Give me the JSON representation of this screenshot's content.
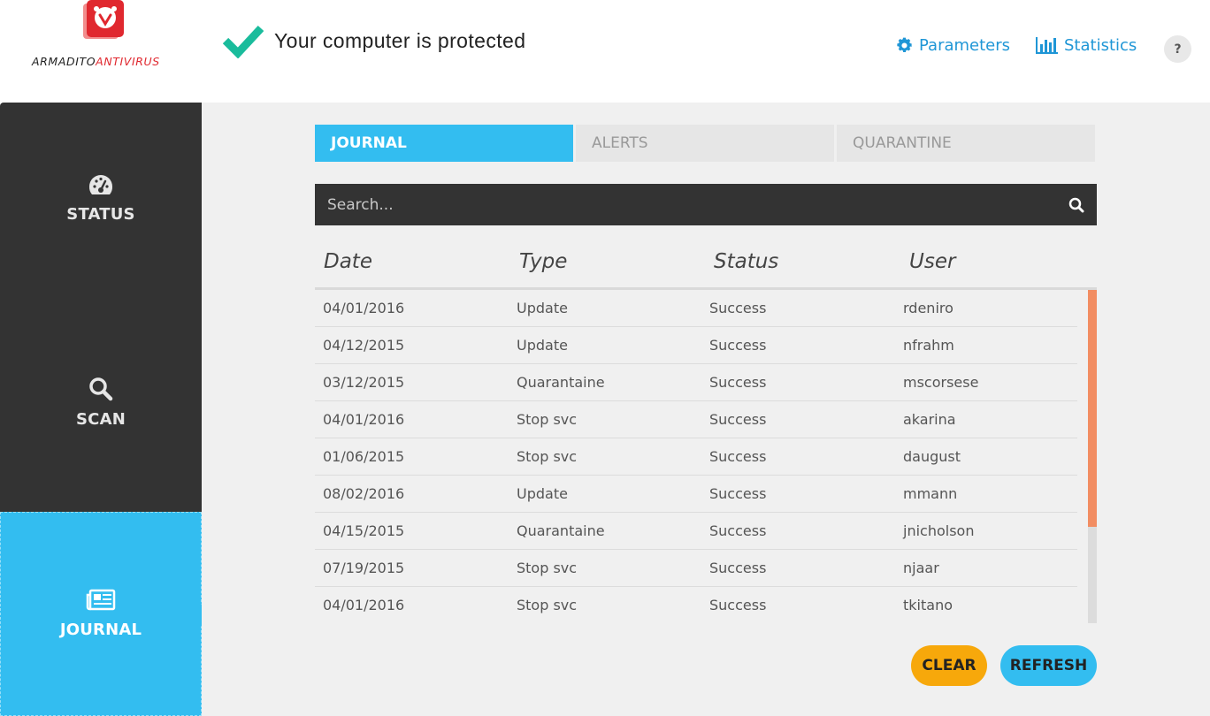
{
  "header": {
    "logo_part1": "ARMADITO",
    "logo_part2": "ANTIVIRUS",
    "status_message": "Your computer is protected",
    "parameters_label": "Parameters",
    "statistics_label": "Statistics",
    "help_label": "?"
  },
  "sidebar": {
    "items": [
      {
        "label": "STATUS",
        "icon": "gauge-icon"
      },
      {
        "label": "SCAN",
        "icon": "magnifier-icon"
      },
      {
        "label": "JOURNAL",
        "icon": "newspaper-icon",
        "active": true
      }
    ]
  },
  "tabs": [
    {
      "label": "JOURNAL",
      "active": true
    },
    {
      "label": "ALERTS",
      "active": false
    },
    {
      "label": "QUARANTINE",
      "active": false
    }
  ],
  "search": {
    "placeholder": "Search...",
    "value": ""
  },
  "table": {
    "columns": [
      "Date",
      "Type",
      "Status",
      "User"
    ],
    "rows": [
      [
        "04/01/2016",
        "Update",
        "Success",
        "rdeniro"
      ],
      [
        "04/12/2015",
        "Update",
        "Success",
        "nfrahm"
      ],
      [
        "03/12/2015",
        "Quarantaine",
        "Success",
        "mscorsese"
      ],
      [
        "04/01/2016",
        "Stop svc",
        "Success",
        "akarina"
      ],
      [
        "01/06/2015",
        "Stop svc",
        "Success",
        "daugust"
      ],
      [
        "08/02/2016",
        "Update",
        "Success",
        "mmann"
      ],
      [
        "04/15/2015",
        "Quarantaine",
        "Success",
        "jnicholson"
      ],
      [
        "07/19/2015",
        "Stop svc",
        "Success",
        "njaar"
      ],
      [
        "04/01/2016",
        "Stop svc",
        "Success",
        "tkitano"
      ]
    ]
  },
  "actions": {
    "clear_label": "CLEAR",
    "refresh_label": "REFRESH"
  },
  "colors": {
    "accent": "#33bdf0",
    "sidebar": "#333333",
    "clear_button": "#f7a80b",
    "check": "#1abc9c",
    "link": "#1f96d6",
    "scroll_thumb": "#f28d62",
    "logo_red": "#e0282f"
  }
}
